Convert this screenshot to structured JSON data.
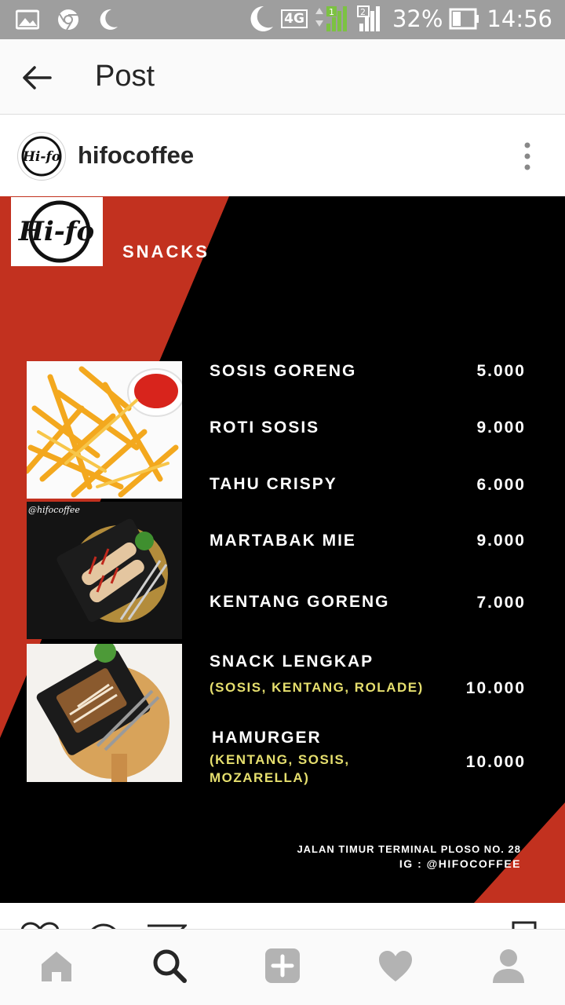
{
  "status_bar": {
    "icons_left": [
      "gallery-icon",
      "chrome-icon",
      "moon-icon"
    ],
    "network": "4G",
    "sim1": "1",
    "sim2": "2",
    "battery": "32%",
    "time": "14:56"
  },
  "header": {
    "title": "Post"
  },
  "post": {
    "username": "hifocoffee",
    "avatar_logo_text": "Hi-fo"
  },
  "menu": {
    "logo_text": "Hi-fo",
    "heading": "SNACKS",
    "photo_watermark": "@hifocoffee",
    "items": [
      {
        "name": "SOSIS GORENG",
        "price": "5.000"
      },
      {
        "name": "ROTI SOSIS",
        "price": "9.000"
      },
      {
        "name": "TAHU CRISPY",
        "price": "6.000"
      },
      {
        "name": "MARTABAK MIE",
        "price": "9.000"
      },
      {
        "name": "KENTANG GORENG",
        "price": "7.000"
      },
      {
        "name": "SNACK LENGKAP",
        "sub": "(SOSIS, KENTANG, ROLADE)",
        "price": "10.000"
      },
      {
        "name": "HAMURGER",
        "sub_line1": "(KENTANG, SOSIS,",
        "sub_line2": "MOZARELLA)",
        "price": "10.000"
      }
    ],
    "address": "JALAN TIMUR TERMINAL PLOSO NO. 28",
    "instagram": "IG : @HIFOCOFFEE"
  },
  "colors": {
    "accent_red": "#c2311f",
    "sub_text": "#e6df6e",
    "status_bar": "#9e9e9e"
  },
  "bottom_nav": [
    "home-icon",
    "search-icon",
    "add-icon",
    "heart-icon",
    "profile-icon"
  ]
}
